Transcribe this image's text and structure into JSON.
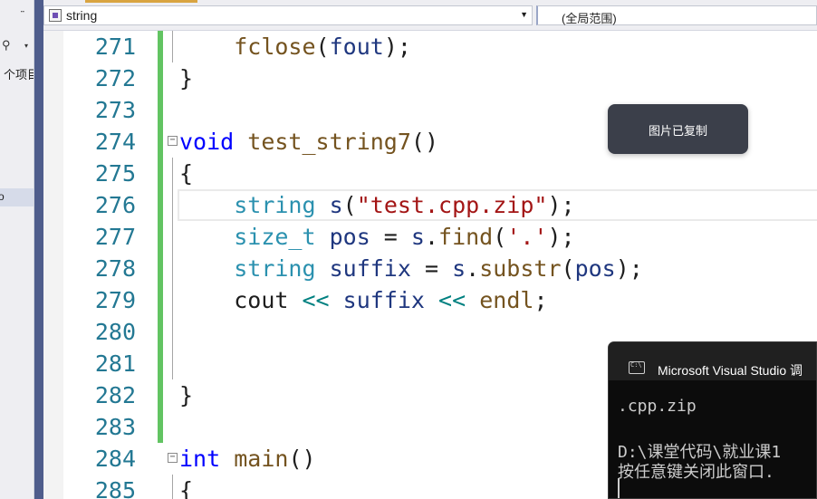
{
  "side_panel": {
    "pin_glyph": "ᐧᐧ",
    "search_icon": "search-icon",
    "search_glyph": "⚲",
    "project_label": "个项目",
    "selected_item_label": "o"
  },
  "nav": {
    "scope_combo_value": "string",
    "member_combo_value": "(全局范围)",
    "dropdown_glyph": "▼"
  },
  "editor": {
    "lines": [
      {
        "num": "271"
      },
      {
        "num": "272"
      },
      {
        "num": "273"
      },
      {
        "num": "274"
      },
      {
        "num": "275"
      },
      {
        "num": "276"
      },
      {
        "num": "277"
      },
      {
        "num": "278"
      },
      {
        "num": "279"
      },
      {
        "num": "280"
      },
      {
        "num": "281"
      },
      {
        "num": "282"
      },
      {
        "num": "283"
      },
      {
        "num": "284"
      },
      {
        "num": "285"
      }
    ],
    "code": {
      "l271": {
        "fn": "fclose",
        "p1": "(",
        "id": "fout",
        "p2": ");"
      },
      "l272": {
        "t": "}"
      },
      "l274": {
        "kw": "void",
        "fn": "test_string7",
        "p": "()"
      },
      "l275": {
        "t": "{"
      },
      "l276": {
        "ty": "string",
        "id": "s",
        "p1": "(",
        "str": "\"test.cpp.zip\"",
        "p2": ");"
      },
      "l277": {
        "ty": "size_t",
        "id": "pos",
        "eq": " = ",
        "id2": "s",
        "dot": ".",
        "fn": "find",
        "p1": "(",
        "str": "'.'",
        "p2": ");"
      },
      "l278": {
        "ty": "string",
        "id": "suffix",
        "eq": " = ",
        "id2": "s",
        "dot": ".",
        "fn": "substr",
        "p1": "(",
        "id3": "pos",
        "p2": ");"
      },
      "l279": {
        "ty": "cout",
        "op1": "<<",
        "id": "suffix",
        "op2": "<<",
        "fn": "endl",
        "semi": ";"
      },
      "l282": {
        "t": "}"
      },
      "l284": {
        "kw": "int",
        "fn": "main",
        "p": "()"
      },
      "l285": {
        "t": "{"
      }
    },
    "fold_glyph": "−"
  },
  "toast": {
    "text": "图片已复制"
  },
  "console": {
    "title": "Microsoft Visual Studio 调",
    "output_line1": ".cpp.zip",
    "output_line2": "D:\\课堂代码\\就业课1",
    "output_line3": "按任意键关闭此窗口."
  },
  "colors": {
    "keyword": "#0000ff",
    "type": "#2b91af",
    "function": "#74531f",
    "string": "#a31515",
    "identifier": "#1f377f",
    "operator": "#008080",
    "line_number": "#237893",
    "change_bar": "#62c462"
  }
}
